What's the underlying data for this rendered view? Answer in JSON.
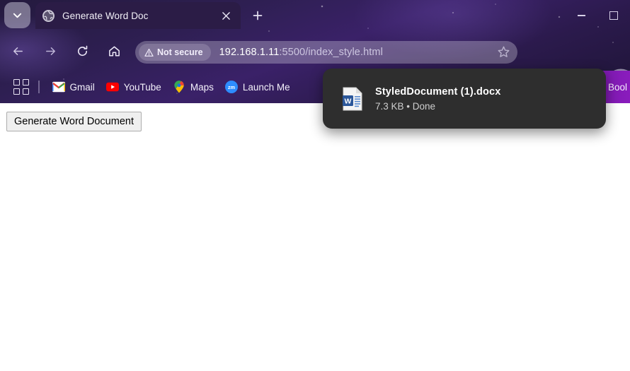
{
  "window": {
    "title": "Generate Word Doc",
    "controls": {
      "minimize": "minimize",
      "maximize": "maximize"
    }
  },
  "tabstrip": {
    "tab_search_icon": "chevron-down-icon",
    "new_tab_icon": "plus-icon",
    "tabs": [
      {
        "title": "Generate Word Doc",
        "favicon": "globe-icon",
        "close_icon": "close-icon",
        "active": true
      }
    ]
  },
  "toolbar": {
    "back_icon": "arrow-left-icon",
    "forward_icon": "arrow-right-icon",
    "reload_icon": "reload-icon",
    "home_icon": "home-icon",
    "security_label": "Not secure",
    "security_icon": "warning-triangle-icon",
    "url_host": "192.168.1.11",
    "url_port": ":5500",
    "url_path": "/index_style.html",
    "url_full": "192.168.1.11:5500/index_style.html",
    "bookmark_star_icon": "star-icon",
    "extensions_icon": "puzzle-piece-icon",
    "downloads_icon": "download-icon",
    "avatar": "profile-avatar"
  },
  "bookmarks_bar": {
    "apps_icon": "apps-grid-icon",
    "items": [
      {
        "label": "Gmail",
        "icon": "gmail-icon"
      },
      {
        "label": "YouTube",
        "icon": "youtube-icon"
      },
      {
        "label": "Maps",
        "icon": "google-maps-icon"
      },
      {
        "label": "Launch Me",
        "icon": "zoom-icon"
      }
    ],
    "overflow_label": "Bool"
  },
  "download_bubble": {
    "file_icon": "word-document-icon",
    "filename": "StyledDocument (1).docx",
    "meta": "7.3 KB • Done"
  },
  "page": {
    "generate_button_label": "Generate Word Document"
  },
  "colors": {
    "chrome_purple": "#3a2168",
    "bookmark_accent": "#8a1cbd",
    "bubble_bg": "#2e2e2e",
    "page_bg": "#ffffff",
    "word_blue": "#2b579a"
  }
}
